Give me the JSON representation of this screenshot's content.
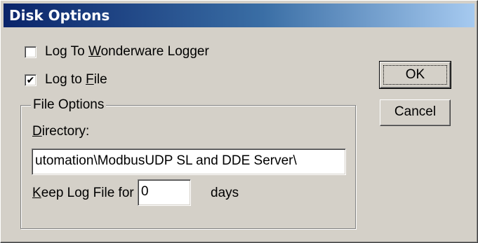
{
  "window": {
    "title": "Disk Options"
  },
  "options": {
    "log_to_logger": {
      "label_pre": "Log To ",
      "label_key": "W",
      "label_post": "onderware Logger",
      "checked": false
    },
    "log_to_file": {
      "label_pre": "Log to ",
      "label_key": "F",
      "label_post": "ile",
      "checked": true,
      "check_glyph": "✔"
    }
  },
  "file_options": {
    "legend": "File Options",
    "directory_label_key": "D",
    "directory_label_post": "irectory:",
    "directory_value": "utomation\\ModbusUDP SL and DDE Server\\",
    "keep_label_key": "K",
    "keep_label_post": "eep Log File for",
    "keep_value": "0",
    "days_label": "days"
  },
  "buttons": {
    "ok": "OK",
    "cancel": "Cancel"
  },
  "colors": {
    "title_start": "#0a246a",
    "title_end": "#a6caf0",
    "face": "#d4d0c8"
  }
}
